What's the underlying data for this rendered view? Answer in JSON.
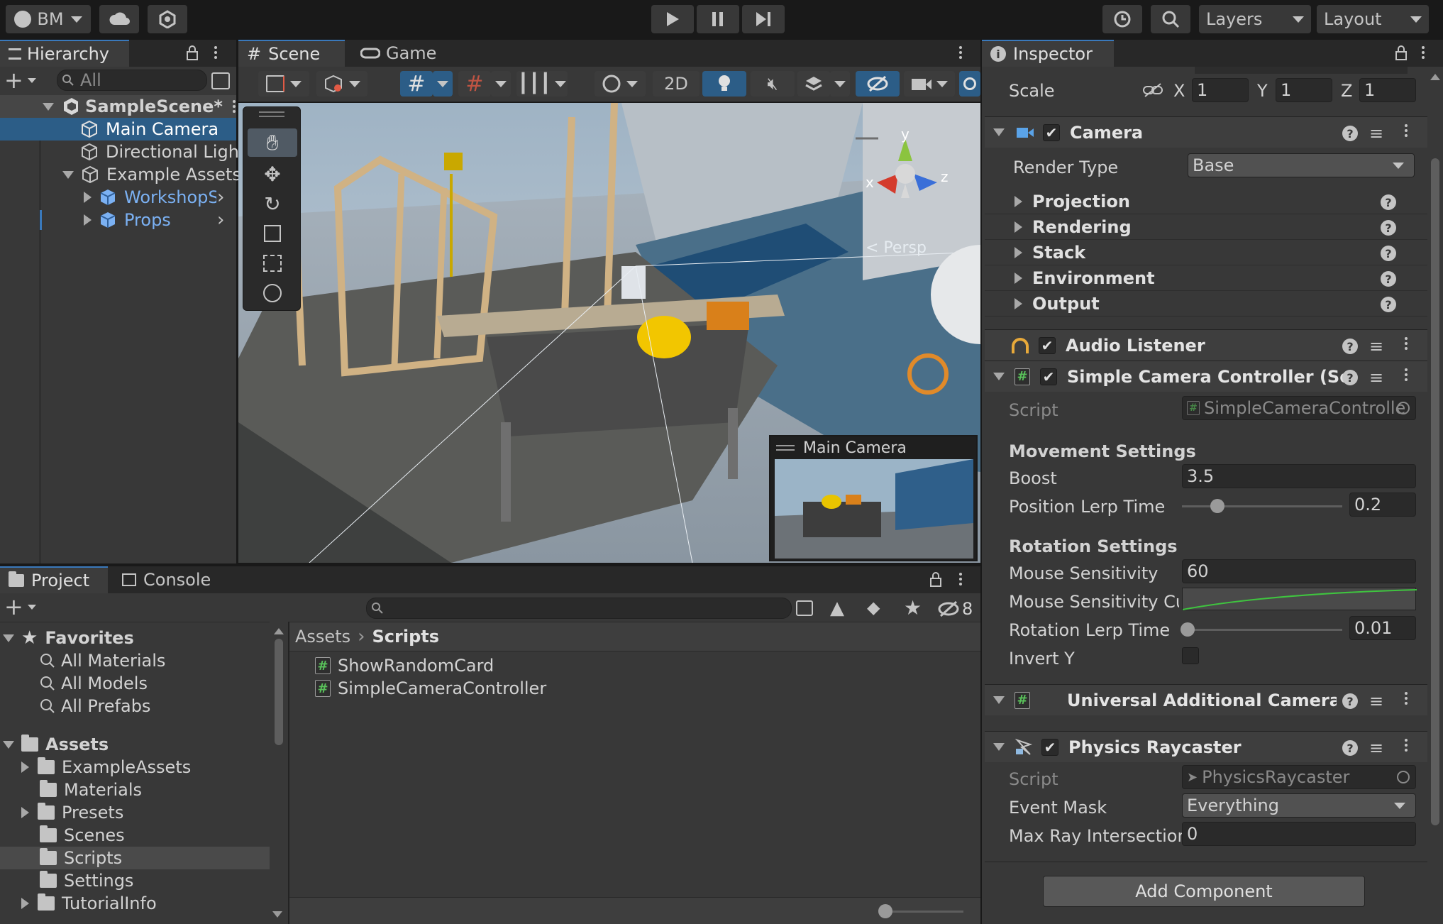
{
  "toolbar": {
    "account": "BM",
    "layers": "Layers",
    "layout": "Layout"
  },
  "hierarchy": {
    "tab": "Hierarchy",
    "search_placeholder": "All",
    "scene": "SampleScene*",
    "items": [
      {
        "label": "Main Camera"
      },
      {
        "label": "Directional Light"
      },
      {
        "label": "Example Assets"
      },
      {
        "label": "WorkshopS"
      },
      {
        "label": "Props"
      }
    ]
  },
  "scene_view": {
    "tabs": [
      {
        "label": "Scene"
      },
      {
        "label": "Game"
      }
    ],
    "btn_2d": "2D",
    "gizmo_x": "x",
    "gizmo_y": "y",
    "gizmo_z": "z",
    "persp": "< Persp",
    "camera_preview_title": "Main Camera"
  },
  "project": {
    "tabs": [
      {
        "label": "Project"
      },
      {
        "label": "Console"
      }
    ],
    "hidden_count": "8",
    "favorites": {
      "label": "Favorites",
      "items": [
        "All Materials",
        "All Models",
        "All Prefabs"
      ]
    },
    "assets": {
      "label": "Assets",
      "items": [
        "ExampleAssets",
        "Materials",
        "Presets",
        "Scenes",
        "Scripts",
        "Settings",
        "TutorialInfo"
      ]
    },
    "breadcrumb": {
      "root": "Assets",
      "current": "Scripts"
    },
    "files": [
      "ShowRandomCard",
      "SimpleCameraController"
    ]
  },
  "inspector": {
    "tab": "Inspector",
    "scale": {
      "label": "Scale",
      "x": "1",
      "y": "1",
      "z": "1"
    },
    "axis": {
      "x": "X",
      "y": "Y",
      "z": "Z"
    },
    "camera": {
      "title": "Camera",
      "render_type_label": "Render Type",
      "render_type_value": "Base",
      "sections": [
        "Projection",
        "Rendering",
        "Stack",
        "Environment",
        "Output"
      ]
    },
    "audio_listener": {
      "title": "Audio Listener"
    },
    "simple_camera": {
      "title": "Simple Camera Controller (Scrip",
      "script_label": "Script",
      "script_value": "SimpleCameraControlle",
      "movement_header": "Movement Settings",
      "boost_label": "Boost",
      "boost_value": "3.5",
      "pos_lerp_label": "Position Lerp Time",
      "pos_lerp_value": "0.2",
      "rotation_header": "Rotation Settings",
      "mouse_sens_label": "Mouse Sensitivity",
      "mouse_sens_value": "60",
      "mouse_curve_label": "Mouse Sensitivity Cu",
      "rot_lerp_label": "Rotation Lerp Time",
      "rot_lerp_value": "0.01",
      "invert_label": "Invert Y"
    },
    "urp_camera": {
      "title": "Universal Additional Camera Da"
    },
    "physics_raycaster": {
      "title": "Physics Raycaster",
      "script_label": "Script",
      "script_value": "PhysicsRaycaster",
      "event_mask_label": "Event Mask",
      "event_mask_value": "Everything",
      "max_ray_label": "Max Ray Intersection",
      "max_ray_value": "0"
    },
    "add_component": "Add Component"
  },
  "colors": {
    "selection": "#2c5d87",
    "tab_accent": "#3a79bb",
    "prefab_blue": "#7bb1f3",
    "script_green": "#59c15a"
  }
}
